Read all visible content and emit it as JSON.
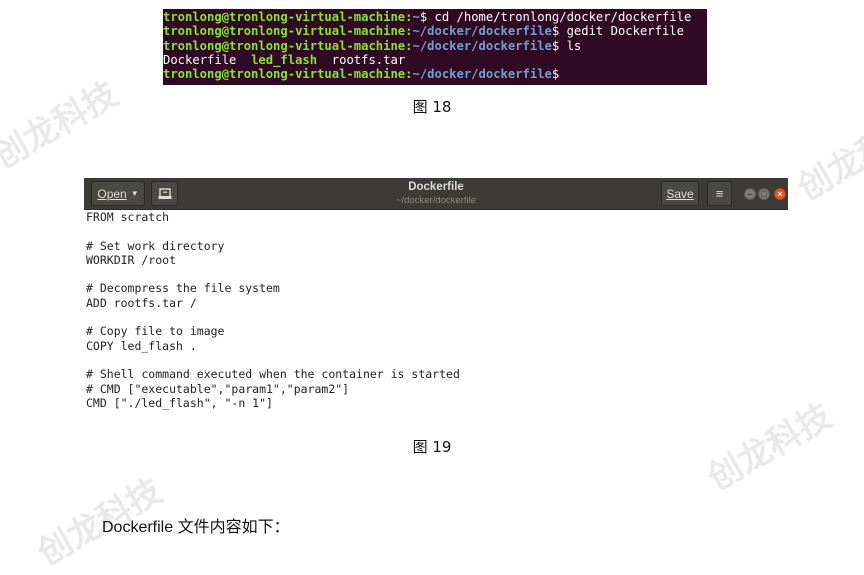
{
  "watermark": "创龙科技",
  "terminal": {
    "lines": [
      [
        {
          "t": "tronlong@tronlong-virtual-machine:",
          "c": "user"
        },
        {
          "t": "~",
          "c": "path"
        },
        {
          "t": "$ cd /home/tronlong/docker/dockerfile",
          "c": "plain"
        }
      ],
      [
        {
          "t": "tronlong@tronlong-virtual-machine:",
          "c": "user"
        },
        {
          "t": "~/docker/dockerfile",
          "c": "path"
        },
        {
          "t": "$ gedit Dockerfile",
          "c": "plain"
        }
      ],
      [
        {
          "t": "tronlong@tronlong-virtual-machine:",
          "c": "user"
        },
        {
          "t": "~/docker/dockerfile",
          "c": "path"
        },
        {
          "t": "$ ls",
          "c": "plain"
        }
      ],
      [
        {
          "t": "Dockerfile  ",
          "c": "plain"
        },
        {
          "t": "led_flash",
          "c": "user"
        },
        {
          "t": "  rootfs.tar",
          "c": "plain"
        }
      ],
      [
        {
          "t": "tronlong@tronlong-virtual-machine:",
          "c": "user"
        },
        {
          "t": "~/docker/dockerfile",
          "c": "path"
        },
        {
          "t": "$",
          "c": "plain"
        }
      ]
    ]
  },
  "caption1": "图  18",
  "gedit": {
    "open_label": "Open",
    "save_label": "Save",
    "title": "Dockerfile",
    "subtitle": "~/docker/dockerfile",
    "menu_icon_glyph": "≡",
    "min_glyph": "–",
    "max_glyph": "□",
    "close_glyph": "×",
    "code_lines": [
      "FROM scratch",
      "",
      "# Set work directory",
      "WORKDIR /root",
      "",
      "# Decompress the file system",
      "ADD rootfs.tar /",
      "",
      "# Copy file to image",
      "COPY led_flash .",
      "",
      "# Shell command executed when the container is started",
      "# CMD [\"executable\",\"param1\",\"param2\"]",
      "CMD [\"./led_flash\", \"-n 1\"]"
    ]
  },
  "caption2": "图  19",
  "body_text": "Dockerfile 文件内容如下："
}
